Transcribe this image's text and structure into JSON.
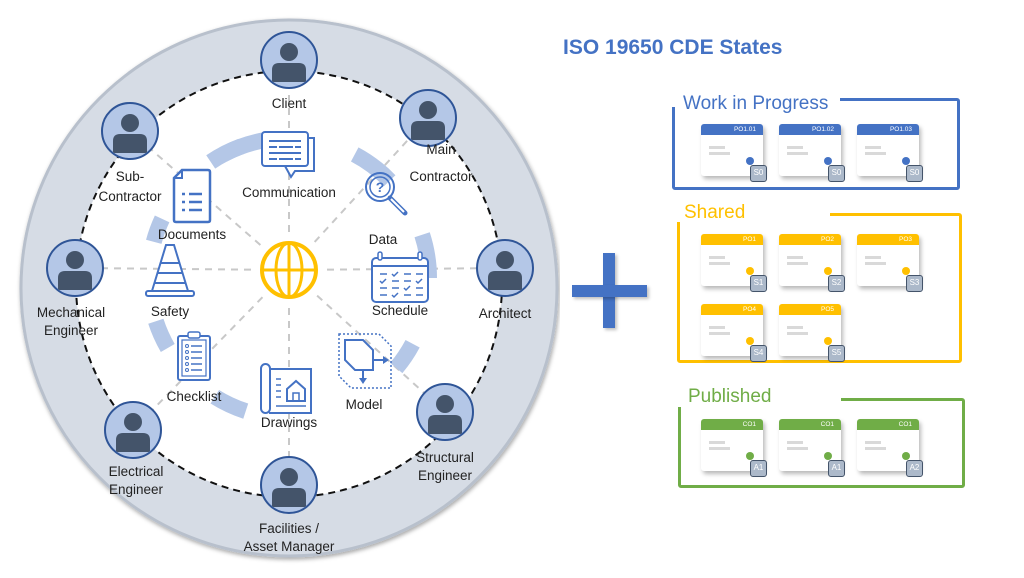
{
  "header": {
    "title": "ISO 19650 CDE States"
  },
  "colors": {
    "primary_blue": "#4472c4",
    "icon_blue": "#4472c4",
    "avatar_fill": "#b4c7e7",
    "avatar_figure": "#44546a",
    "outer_ring": "#d6dce5",
    "globe_yellow": "#ffc000",
    "wip": "#4472c4",
    "shared": "#ffc000",
    "published": "#70ad47"
  },
  "stakeholders": [
    {
      "id": "client",
      "label_lines": [
        "Client"
      ]
    },
    {
      "id": "main-contractor",
      "label_lines": [
        "Main",
        "Contractor"
      ]
    },
    {
      "id": "architect",
      "label_lines": [
        "Architect"
      ]
    },
    {
      "id": "structural-engineer",
      "label_lines": [
        "Structural",
        "Engineer"
      ]
    },
    {
      "id": "facilities-asset-manager",
      "label_lines": [
        "Facilities /",
        "Asset Manager"
      ]
    },
    {
      "id": "electrical-engineer",
      "label_lines": [
        "Electrical",
        "Engineer"
      ]
    },
    {
      "id": "mechanical-engineer",
      "label_lines": [
        "Mechanical",
        "Engineer"
      ]
    },
    {
      "id": "sub-contractor",
      "label_lines": [
        "Sub-",
        "Contractor"
      ]
    }
  ],
  "topics": [
    {
      "id": "communication",
      "label": "Communication",
      "icon": "chat-bubbles-icon"
    },
    {
      "id": "data",
      "label": "Data",
      "icon": "magnifier-question-icon"
    },
    {
      "id": "schedule",
      "label": "Schedule",
      "icon": "calendar-checklist-icon"
    },
    {
      "id": "model",
      "label": "Model",
      "icon": "3d-model-icon"
    },
    {
      "id": "drawings",
      "label": "Drawings",
      "icon": "blueprint-house-icon"
    },
    {
      "id": "checklist",
      "label": "Checklist",
      "icon": "clipboard-icon"
    },
    {
      "id": "safety",
      "label": "Safety",
      "icon": "traffic-cone-icon"
    },
    {
      "id": "documents",
      "label": "Documents",
      "icon": "document-list-icon"
    }
  ],
  "center": {
    "icon": "globe-icon"
  },
  "operator": {
    "icon": "plus-icon"
  },
  "states": [
    {
      "id": "wip",
      "title": "Work in Progress",
      "color": "#4472c4",
      "cards": [
        {
          "code": "PO1.01",
          "status": "S0"
        },
        {
          "code": "PO1.02",
          "status": "S0"
        },
        {
          "code": "PO1.03",
          "status": "S0"
        }
      ]
    },
    {
      "id": "shared",
      "title": "Shared",
      "color": "#ffc000",
      "cards": [
        {
          "code": "PO1",
          "status": "S1"
        },
        {
          "code": "PO2",
          "status": "S2"
        },
        {
          "code": "PO3",
          "status": "S3"
        },
        {
          "code": "PO4",
          "status": "S4"
        },
        {
          "code": "PO5",
          "status": "S5"
        }
      ]
    },
    {
      "id": "published",
      "title": "Published",
      "color": "#70ad47",
      "cards": [
        {
          "code": "CO1",
          "status": "A1"
        },
        {
          "code": "CO1",
          "status": "A1"
        },
        {
          "code": "CO1",
          "status": "A2"
        }
      ]
    }
  ]
}
